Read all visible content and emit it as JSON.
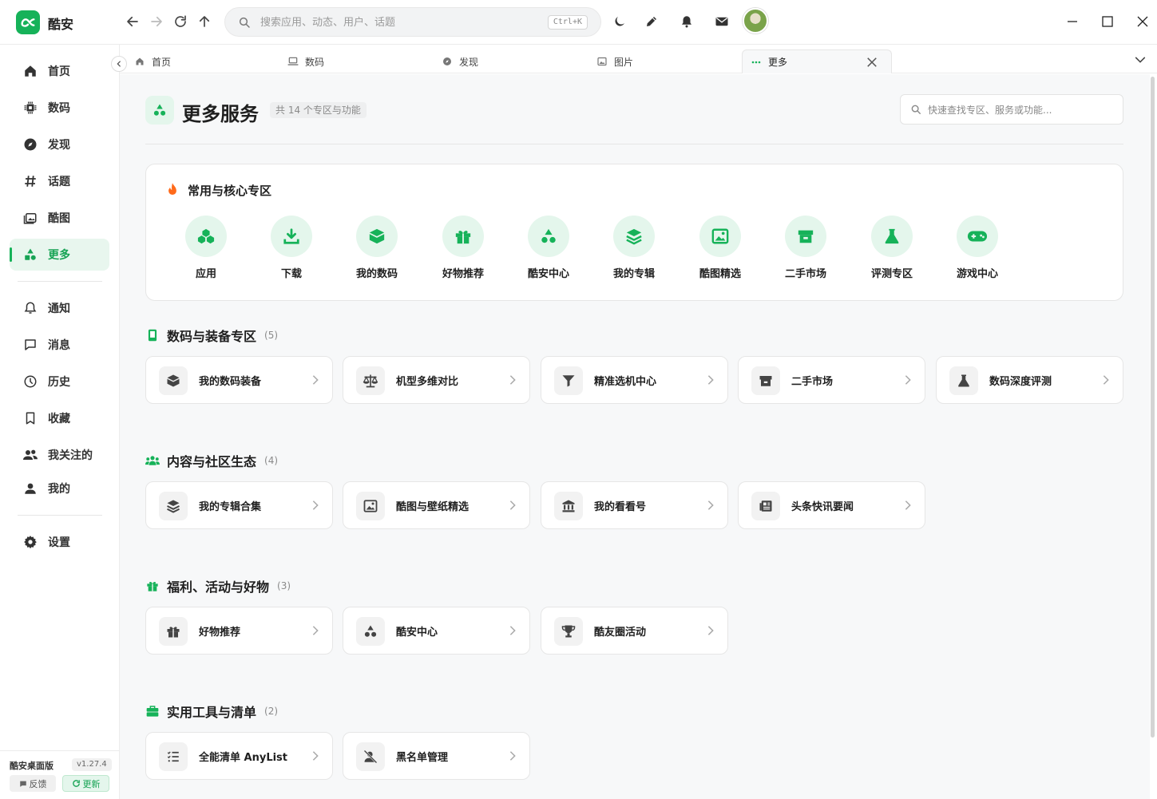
{
  "app": {
    "name": "酷安"
  },
  "search": {
    "placeholder": "搜索应用、动态、用户、话题",
    "shortcut": "Ctrl+K"
  },
  "sidebar": {
    "items": [
      {
        "label": "首页",
        "icon": "home-icon"
      },
      {
        "label": "数码",
        "icon": "chip-icon"
      },
      {
        "label": "发现",
        "icon": "compass-icon"
      },
      {
        "label": "话题",
        "icon": "hashtag-icon"
      },
      {
        "label": "酷图",
        "icon": "images-icon"
      },
      {
        "label": "更多",
        "icon": "shapes-icon",
        "active": true
      },
      {
        "label": "通知",
        "icon": "bell-icon"
      },
      {
        "label": "消息",
        "icon": "message-icon"
      },
      {
        "label": "历史",
        "icon": "clock-icon"
      },
      {
        "label": "收藏",
        "icon": "bookmark-icon"
      },
      {
        "label": "我关注的",
        "icon": "users-icon"
      },
      {
        "label": "我的",
        "icon": "user-icon"
      },
      {
        "label": "设置",
        "icon": "gear-icon"
      }
    ],
    "footer": {
      "app_label": "酷安桌面版",
      "version": "v1.27.4",
      "feedback": "反馈",
      "update": "更新"
    }
  },
  "tabs": [
    {
      "label": "首页",
      "icon": "home-icon"
    },
    {
      "label": "数码",
      "icon": "laptop-icon"
    },
    {
      "label": "发现",
      "icon": "compass-icon"
    },
    {
      "label": "图片",
      "icon": "image-icon"
    },
    {
      "label": "更多",
      "icon": "dots-icon",
      "active": true
    }
  ],
  "page": {
    "title": "更多服务",
    "count": "共 14 个专区与功能",
    "quick_search_placeholder": "快速查找专区、服务或功能..."
  },
  "core": {
    "title": "常用与核心专区",
    "items": [
      {
        "label": "应用",
        "icon": "cubes-icon"
      },
      {
        "label": "下载",
        "icon": "download-icon"
      },
      {
        "label": "我的数码",
        "icon": "box-icon"
      },
      {
        "label": "好物推荐",
        "icon": "gift-icon"
      },
      {
        "label": "酷安中心",
        "icon": "shapes-icon"
      },
      {
        "label": "我的专辑",
        "icon": "layers-icon"
      },
      {
        "label": "酷图精选",
        "icon": "image-icon"
      },
      {
        "label": "二手市场",
        "icon": "store-icon"
      },
      {
        "label": "评测专区",
        "icon": "flask-icon"
      },
      {
        "label": "游戏中心",
        "icon": "gamepad-icon"
      }
    ]
  },
  "sections": [
    {
      "title": "数码与装备专区",
      "count": "(5)",
      "icon": "phone-icon",
      "items": [
        {
          "label": "我的数码装备",
          "icon": "box-icon"
        },
        {
          "label": "机型多维对比",
          "icon": "scale-icon"
        },
        {
          "label": "精准选机中心",
          "icon": "filter-icon"
        },
        {
          "label": "二手市场",
          "icon": "store-icon"
        },
        {
          "label": "数码深度评测",
          "icon": "flask-icon"
        }
      ]
    },
    {
      "title": "内容与社区生态",
      "count": "(4)",
      "icon": "users-icon",
      "items": [
        {
          "label": "我的专辑合集",
          "icon": "layers-icon"
        },
        {
          "label": "酷图与壁纸精选",
          "icon": "image-icon"
        },
        {
          "label": "我的看看号",
          "icon": "bank-icon"
        },
        {
          "label": "头条快讯要闻",
          "icon": "newspaper-icon"
        }
      ]
    },
    {
      "title": "福利、活动与好物",
      "count": "(3)",
      "icon": "gift-icon",
      "items": [
        {
          "label": "好物推荐",
          "icon": "gift-icon"
        },
        {
          "label": "酷安中心",
          "icon": "shapes-icon"
        },
        {
          "label": "酷友圈活动",
          "icon": "trophy-icon"
        }
      ]
    },
    {
      "title": "实用工具与清单",
      "count": "(2)",
      "icon": "toolbox-icon",
      "items": [
        {
          "label": "全能清单 AnyList",
          "icon": "list-icon"
        },
        {
          "label": "黑名单管理",
          "icon": "user-block-icon"
        }
      ]
    }
  ],
  "colors": {
    "accent": "#16b259",
    "accent_bg": "#e4f6ec",
    "flame": "#ff6a1a"
  }
}
